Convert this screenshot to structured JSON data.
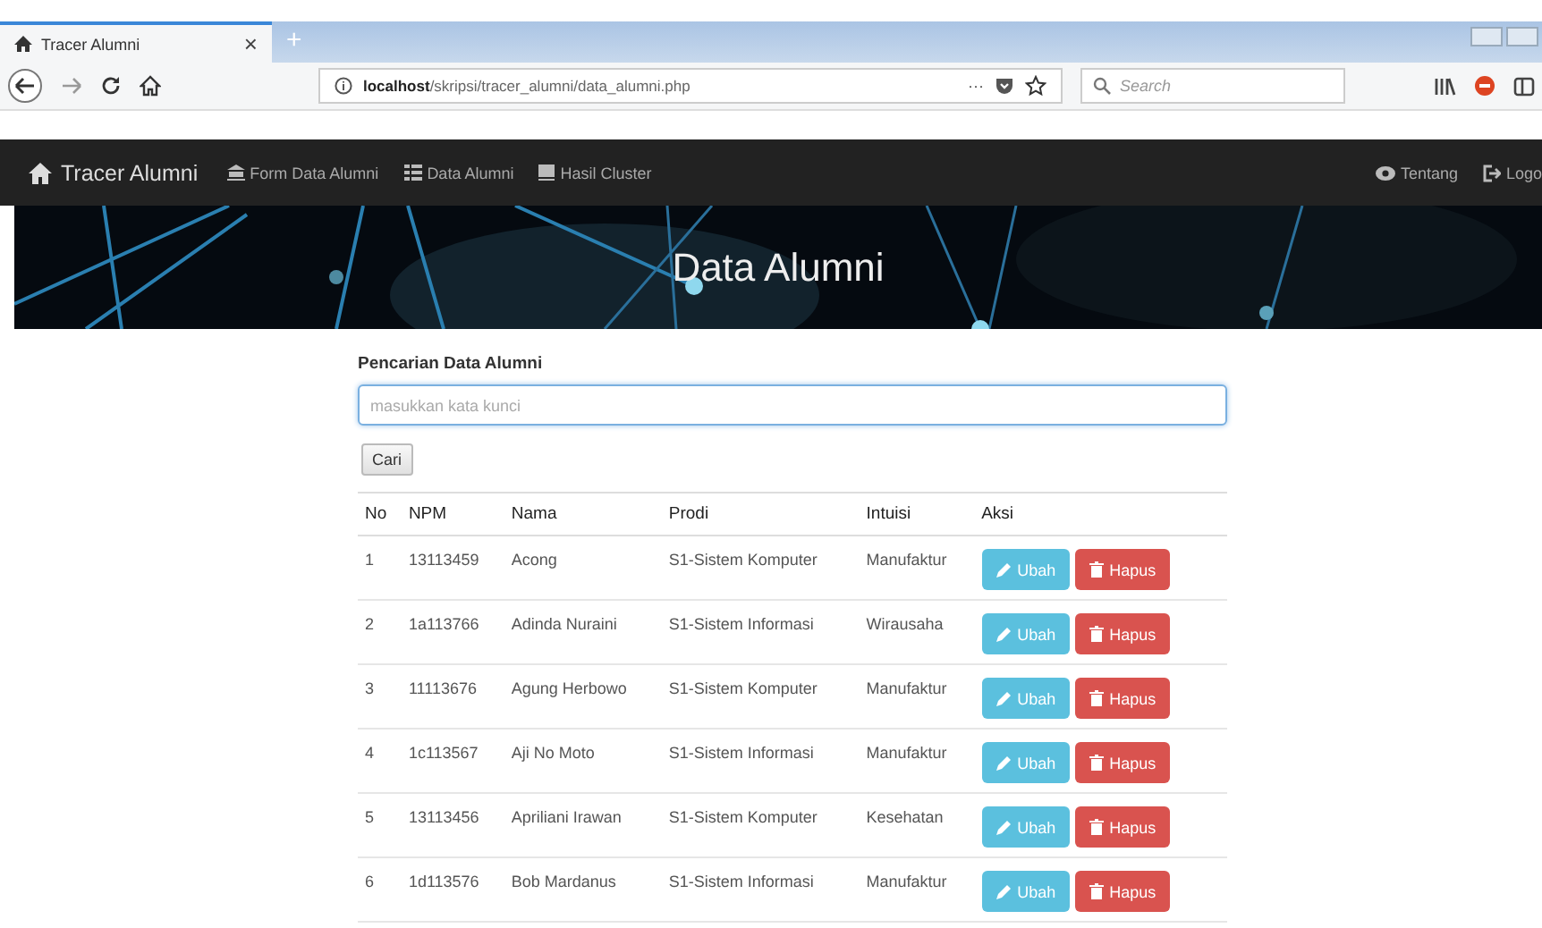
{
  "browser": {
    "tab": {
      "title": "Tracer Alumni",
      "close": "×",
      "selected": true
    },
    "new_tab": "+",
    "url": {
      "host": "localhost",
      "path": "/skripsi/tracer_alumni/data_alumni.php"
    },
    "page_menu": "···",
    "search": {
      "placeholder": "Search"
    }
  },
  "navbar": {
    "brand": "Tracer Alumni",
    "items": [
      {
        "label": "Form Data Alumni"
      },
      {
        "label": "Data Alumni"
      },
      {
        "label": "Hasil Cluster"
      }
    ],
    "right_items": [
      {
        "label": "Tentang"
      },
      {
        "label": "Logo"
      }
    ]
  },
  "banner": {
    "title": "Data Alumni"
  },
  "search": {
    "label": "Pencarian Data Alumni",
    "placeholder": "masukkan kata kunci",
    "button": "Cari"
  },
  "table": {
    "columns": [
      "No",
      "NPM",
      "Nama",
      "Prodi",
      "Intuisi",
      "Aksi"
    ],
    "rows": [
      {
        "cells": [
          "1",
          "13113459",
          "Acong",
          "S1-Sistem Komputer",
          "Manufaktur"
        ],
        "actions": [
          {
            "label": "Ubah",
            "kind": "edit"
          },
          {
            "label": "Hapus",
            "kind": "delete"
          }
        ]
      },
      {
        "cells": [
          "2",
          "1a113766",
          "Adinda Nuraini",
          "S1-Sistem Informasi",
          "Wirausaha"
        ],
        "actions": [
          {
            "label": "Ubah",
            "kind": "edit"
          },
          {
            "label": "Hapus",
            "kind": "delete"
          }
        ]
      },
      {
        "cells": [
          "3",
          "11113676",
          "Agung Herbowo",
          "S1-Sistem Komputer",
          "Manufaktur"
        ],
        "actions": [
          {
            "label": "Ubah",
            "kind": "edit"
          },
          {
            "label": "Hapus",
            "kind": "delete"
          }
        ]
      },
      {
        "cells": [
          "4",
          "1c113567",
          "Aji No Moto",
          "S1-Sistem Informasi",
          "Manufaktur"
        ],
        "actions": [
          {
            "label": "Ubah",
            "kind": "edit"
          },
          {
            "label": "Hapus",
            "kind": "delete"
          }
        ]
      },
      {
        "cells": [
          "5",
          "13113456",
          "Apriliani Irawan",
          "S1-Sistem Komputer",
          "Kesehatan"
        ],
        "actions": [
          {
            "label": "Ubah",
            "kind": "edit"
          },
          {
            "label": "Hapus",
            "kind": "delete"
          }
        ]
      },
      {
        "cells": [
          "6",
          "1d113576",
          "Bob Mardanus",
          "S1-Sistem Informasi",
          "Manufaktur"
        ],
        "actions": [
          {
            "label": "Ubah",
            "kind": "edit"
          },
          {
            "label": "Hapus",
            "kind": "delete"
          }
        ]
      }
    ]
  }
}
